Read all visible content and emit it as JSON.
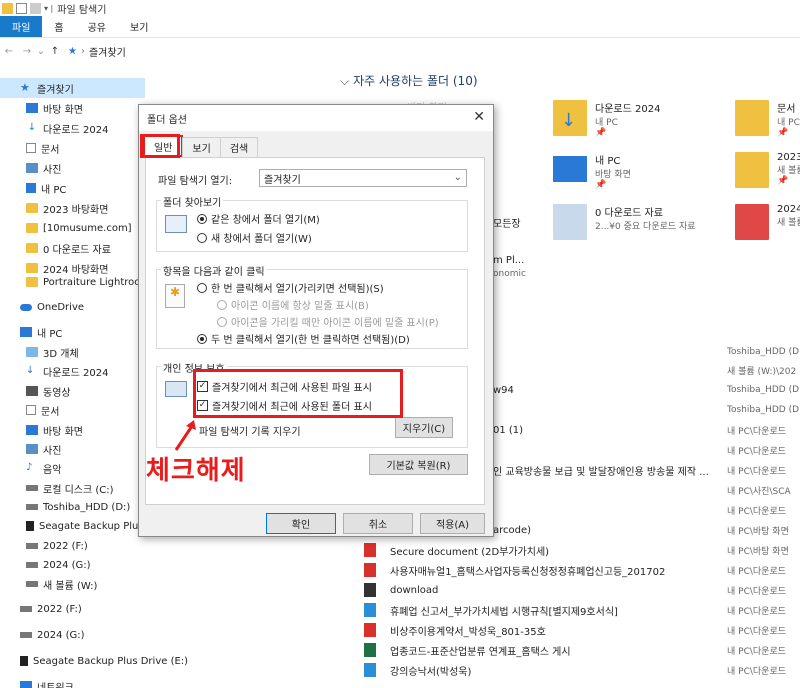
{
  "window": {
    "title": "파일 탐색기"
  },
  "ribbon": {
    "tabs": [
      "파일",
      "홈",
      "공유",
      "보기"
    ]
  },
  "address": {
    "location": "즐겨찾기"
  },
  "sidebar": {
    "items": [
      {
        "label": "즐겨찾기",
        "icon": "star-icon"
      },
      {
        "label": "바탕 화면",
        "icon": "desktop-icon"
      },
      {
        "label": "다운로드 2024",
        "icon": "download-icon"
      },
      {
        "label": "문서",
        "icon": "document-icon"
      },
      {
        "label": "사진",
        "icon": "picture-icon"
      },
      {
        "label": "내 PC",
        "icon": "pc-icon"
      },
      {
        "label": "2023 바탕화면",
        "icon": "folder-icon"
      },
      {
        "label": "[10musume.com]",
        "icon": "folder-icon"
      },
      {
        "label": "0 다운로드 자료",
        "icon": "folder-icon"
      },
      {
        "label": "2024 바탕화면",
        "icon": "folder-icon"
      },
      {
        "label": "Portraiture Lightroom",
        "icon": "folder-icon"
      },
      {
        "label": "OneDrive",
        "icon": "cloud-icon"
      },
      {
        "label": "내 PC",
        "icon": "pc-icon"
      },
      {
        "label": "3D 개체",
        "icon": "cube-icon"
      },
      {
        "label": "다운로드 2024",
        "icon": "download-icon"
      },
      {
        "label": "동영상",
        "icon": "video-icon"
      },
      {
        "label": "문서",
        "icon": "document-icon"
      },
      {
        "label": "바탕 화면",
        "icon": "desktop-icon"
      },
      {
        "label": "사진",
        "icon": "picture-icon"
      },
      {
        "label": "음악",
        "icon": "music-icon"
      },
      {
        "label": "로컬 디스크 (C:)",
        "icon": "drive-icon"
      },
      {
        "label": "Toshiba_HDD (D:)",
        "icon": "drive-icon"
      },
      {
        "label": "Seagate Backup Plus D",
        "icon": "drive-icon"
      },
      {
        "label": "2022 (F:)",
        "icon": "drive-icon"
      },
      {
        "label": "2024 (G:)",
        "icon": "drive-icon"
      },
      {
        "label": "새 볼륨 (W:)",
        "icon": "drive-icon"
      },
      {
        "label": "2022 (F:)",
        "icon": "drive-icon"
      },
      {
        "label": "2024 (G:)",
        "icon": "drive-icon"
      },
      {
        "label": "Seagate Backup Plus Drive (E:)",
        "icon": "drive-icon"
      },
      {
        "label": "네트워크",
        "icon": "network-icon"
      }
    ]
  },
  "main": {
    "section_title": "자주 사용하는 폴더 (10)",
    "tiles": [
      {
        "name": "다운로드 2024",
        "sub": "내 PC"
      },
      {
        "name": "문서",
        "sub": "내 PC"
      },
      {
        "name": "내 PC",
        "sub": "바탕 화면"
      },
      {
        "name": "2023 b",
        "sub": "새 볼륨"
      },
      {
        "name": "0 다운로드 자료",
        "sub": "2...¥0 중요 다운로드 자료"
      },
      {
        "name": "2024 b",
        "sub": "새 볼륨"
      }
    ],
    "hidden_fragments": [
      "바탕 화면",
      "모든장",
      "m Pl...",
      "onomic",
      "w94",
      "01 (1)",
      "인 교육방송물 보급 및 발달장애인용 방송물 제작 ...",
      "arcode)"
    ],
    "files": [
      {
        "name": "Secure document (2D부가가치세)",
        "icon": "pdf-icon"
      },
      {
        "name": "사용자매뉴얼1_홈택스사업자등록신청정정휴폐업신고등_201702",
        "icon": "pdf-icon"
      },
      {
        "name": "download",
        "icon": "zip-icon"
      },
      {
        "name": "휴폐업 신고서_부가가치세법 시행규칙[별지제9호서식]",
        "icon": "hwp-icon"
      },
      {
        "name": "비상주이용계약서_박성욱_801-35호",
        "icon": "pdf-icon"
      },
      {
        "name": "업종코드-표준산업분류 연계표_홈택스 게시",
        "icon": "excel-icon"
      },
      {
        "name": "강의승낙서(박성욱)",
        "icon": "hwp-icon"
      }
    ],
    "locations": [
      "Toshiba_HDD (D",
      "새 볼륨 (W:)\\202",
      "Toshiba_HDD (D",
      "Toshiba_HDD (D",
      "내 PC\\다운로드",
      "내 PC\\다운로드",
      "내 PC\\다운로드",
      "내 PC\\사진\\SCA",
      "내 PC\\다운로드",
      "내 PC\\바탕 화면",
      "내 PC\\바탕 화면",
      "내 PC\\다운로드",
      "내 PC\\다운로드",
      "내 PC\\다운로드",
      "내 PC\\다운로드",
      "내 PC\\다운로드",
      "내 PC\\다운로드"
    ]
  },
  "dialog": {
    "title": "폴더 옵션",
    "close": "✕",
    "tabs": [
      "일반",
      "보기",
      "검색"
    ],
    "open_label": "파일 탐색기 열기:",
    "open_value": "즐겨찾기",
    "browse_group": "폴더 찾아보기",
    "browse_same": "같은 창에서 폴더 열기(M)",
    "browse_new": "새 창에서 폴더 열기(W)",
    "click_group": "항목을 다음과 같이 클릭",
    "single_click": "한 번 클릭해서 열기(가리키면 선택됨)(S)",
    "underline_always": "아이콘 이름에 항상 밑줄 표시(B)",
    "underline_hover": "아이콘을 가리킬 때만 아이콘 이름에 밑줄 표시(P)",
    "double_click": "두 번 클릭해서 열기(한 번 클릭하면 선택됨)(D)",
    "privacy_group": "개인 정보 보호",
    "recent_files": "즐겨찾기에서 최근에 사용된 파일 표시",
    "recent_folders": "즐겨찾기에서 최근에 사용된 폴더 표시",
    "clear_history": "파일 탐색기 기록 지우기",
    "clear_btn": "지우기(C)",
    "restore_btn": "기본값 복원(R)",
    "ok": "확인",
    "cancel": "취소",
    "apply": "적용(A)"
  },
  "annotation": {
    "text": "체크해제",
    "color": "#e81c1c"
  },
  "colors": {
    "accent": "#1979ca",
    "highlight": "#e81c1c",
    "folder": "#f0c040"
  }
}
